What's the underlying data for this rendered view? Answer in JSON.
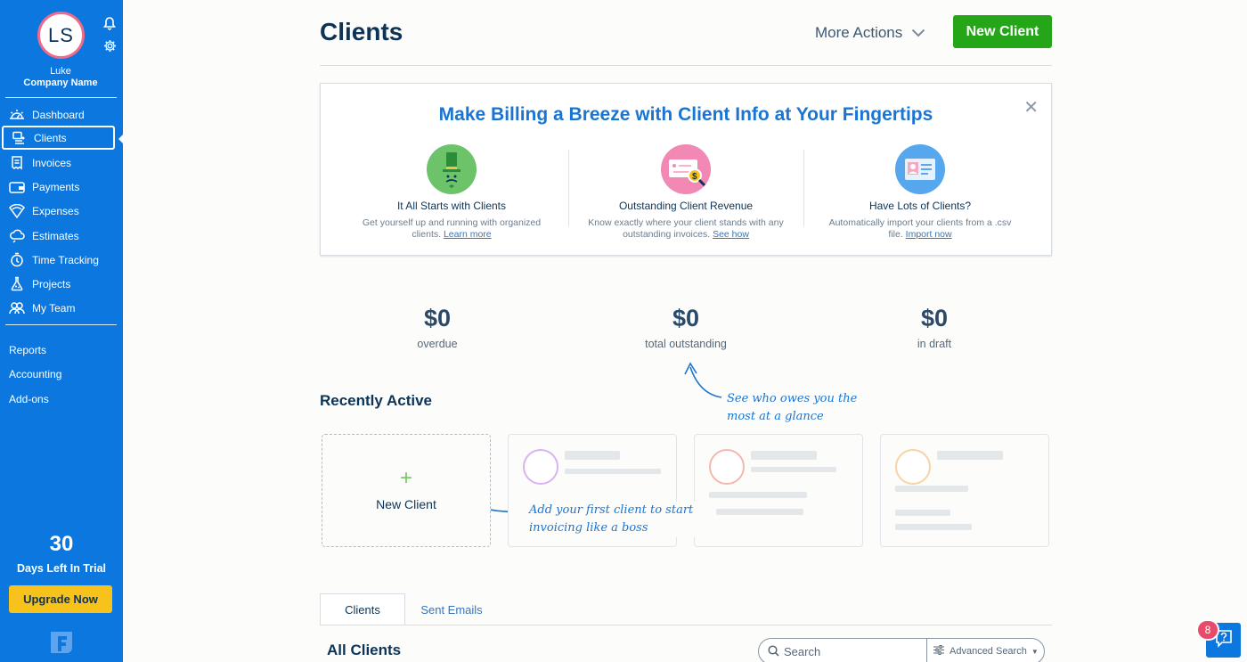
{
  "sidebar": {
    "avatar_initials": "LS",
    "user_name": "Luke",
    "company_name": "Company Name",
    "nav_items": [
      {
        "label": "Dashboard",
        "icon": "dashboard-icon"
      },
      {
        "label": "Clients",
        "icon": "clients-icon",
        "active": true
      },
      {
        "label": "Invoices",
        "icon": "invoices-icon"
      },
      {
        "label": "Payments",
        "icon": "payments-icon"
      },
      {
        "label": "Expenses",
        "icon": "expenses-icon"
      },
      {
        "label": "Estimates",
        "icon": "estimates-icon"
      },
      {
        "label": "Time Tracking",
        "icon": "time-tracking-icon"
      },
      {
        "label": "Projects",
        "icon": "projects-icon"
      },
      {
        "label": "My Team",
        "icon": "my-team-icon"
      }
    ],
    "secondary_links": [
      "Reports",
      "Accounting",
      "Add-ons"
    ],
    "trial_days": "30",
    "trial_label": "Days Left In Trial",
    "upgrade_label": "Upgrade Now"
  },
  "header": {
    "title": "Clients",
    "more_actions": "More Actions",
    "new_client": "New Client"
  },
  "banner": {
    "title": "Make Billing a Breeze with Client Info at Your Fingertips",
    "features": [
      {
        "title": "It All Starts with Clients",
        "desc": "Get yourself up and running with organized clients.",
        "link": "Learn more",
        "icon": "top-hat-icon"
      },
      {
        "title": "Outstanding Client Revenue",
        "desc": "Know exactly where your client stands with any outstanding invoices.",
        "link": "See how",
        "icon": "invoice-magnifier-icon"
      },
      {
        "title": "Have Lots of Clients?",
        "desc": "Automatically import your clients from a .csv file.",
        "link": "Import now",
        "icon": "contact-card-icon"
      }
    ]
  },
  "stats": [
    {
      "amount": "$0",
      "label": "overdue"
    },
    {
      "amount": "$0",
      "label": "total outstanding"
    },
    {
      "amount": "$0",
      "label": "in draft"
    }
  ],
  "annotations": {
    "stats_hint_line1": "See who owes you the",
    "stats_hint_line2": "most at a glance",
    "new_client_hint_line1": "Add your first client to start",
    "new_client_hint_line2": "invoicing like a boss"
  },
  "recently_active": {
    "title": "Recently Active",
    "new_client_label": "New Client",
    "placeholder_colors": [
      "#d9b3f0",
      "#f4b9ae",
      "#f7d3a6"
    ]
  },
  "tabs": [
    {
      "label": "Clients",
      "active": true
    },
    {
      "label": "Sent Emails",
      "active": false
    }
  ],
  "list": {
    "title": "All Clients",
    "search_placeholder": "Search",
    "advanced_search": "Advanced Search"
  },
  "help": {
    "badge_count": "8"
  },
  "colors": {
    "sidebar": "#0b77df",
    "primary_green": "#25a619",
    "upgrade_yellow": "#f6c21b",
    "link_blue": "#1a75d2"
  }
}
